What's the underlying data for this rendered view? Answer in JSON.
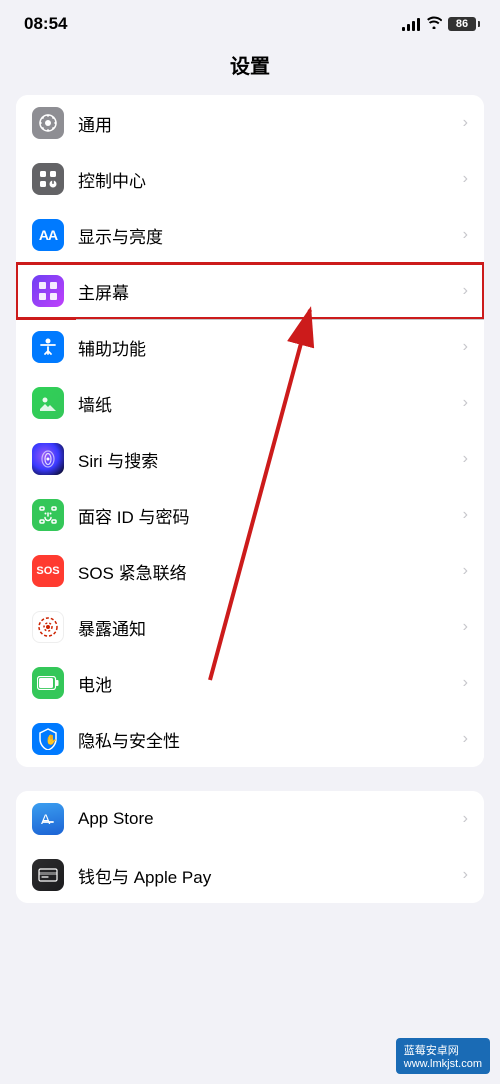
{
  "statusBar": {
    "time": "08:54",
    "battery": "86"
  },
  "pageTitle": "设置",
  "mainSection": {
    "items": [
      {
        "id": "general",
        "label": "通用",
        "iconColor": "icon-gray",
        "iconSymbol": "⚙",
        "highlighted": false
      },
      {
        "id": "control-center",
        "label": "控制中心",
        "iconColor": "icon-gray2",
        "iconSymbol": "⊞",
        "highlighted": false
      },
      {
        "id": "display",
        "label": "显示与亮度",
        "iconColor": "icon-blue",
        "iconSymbol": "AA",
        "highlighted": false
      },
      {
        "id": "home-screen",
        "label": "主屏幕",
        "iconColor": "icon-purple",
        "iconSymbol": "⊞",
        "highlighted": true
      },
      {
        "id": "accessibility",
        "label": "辅助功能",
        "iconColor": "icon-blue",
        "iconSymbol": "♿",
        "highlighted": false
      },
      {
        "id": "wallpaper",
        "label": "墙纸",
        "iconColor": "icon-teal",
        "iconSymbol": "✿",
        "highlighted": false
      },
      {
        "id": "siri",
        "label": "Siri 与搜索",
        "iconColor": "icon-siri",
        "iconSymbol": "◉",
        "highlighted": false
      },
      {
        "id": "faceid",
        "label": "面容 ID 与密码",
        "iconColor": "icon-green",
        "iconSymbol": "◎",
        "highlighted": false
      },
      {
        "id": "sos",
        "label": "SOS 紧急联络",
        "iconColor": "icon-red",
        "iconSymbol": "SOS",
        "highlighted": false
      },
      {
        "id": "exposure",
        "label": "暴露通知",
        "iconColor": "icon-red",
        "iconSymbol": "✳",
        "highlighted": false
      },
      {
        "id": "battery",
        "label": "电池",
        "iconColor": "icon-green",
        "iconSymbol": "▬",
        "highlighted": false
      },
      {
        "id": "privacy",
        "label": "隐私与安全性",
        "iconColor": "icon-blue",
        "iconSymbol": "✋",
        "highlighted": false
      }
    ]
  },
  "bottomSection": {
    "items": [
      {
        "id": "appstore",
        "label": "App Store",
        "iconColor": "icon-appstore",
        "iconSymbol": "A",
        "highlighted": false
      },
      {
        "id": "wallet",
        "label": "钱包与 Apple Pay",
        "iconColor": "icon-wallet",
        "iconSymbol": "▤",
        "highlighted": false
      }
    ]
  },
  "watermark": "蓝莓安卓网\nwww.lmkjst.com"
}
